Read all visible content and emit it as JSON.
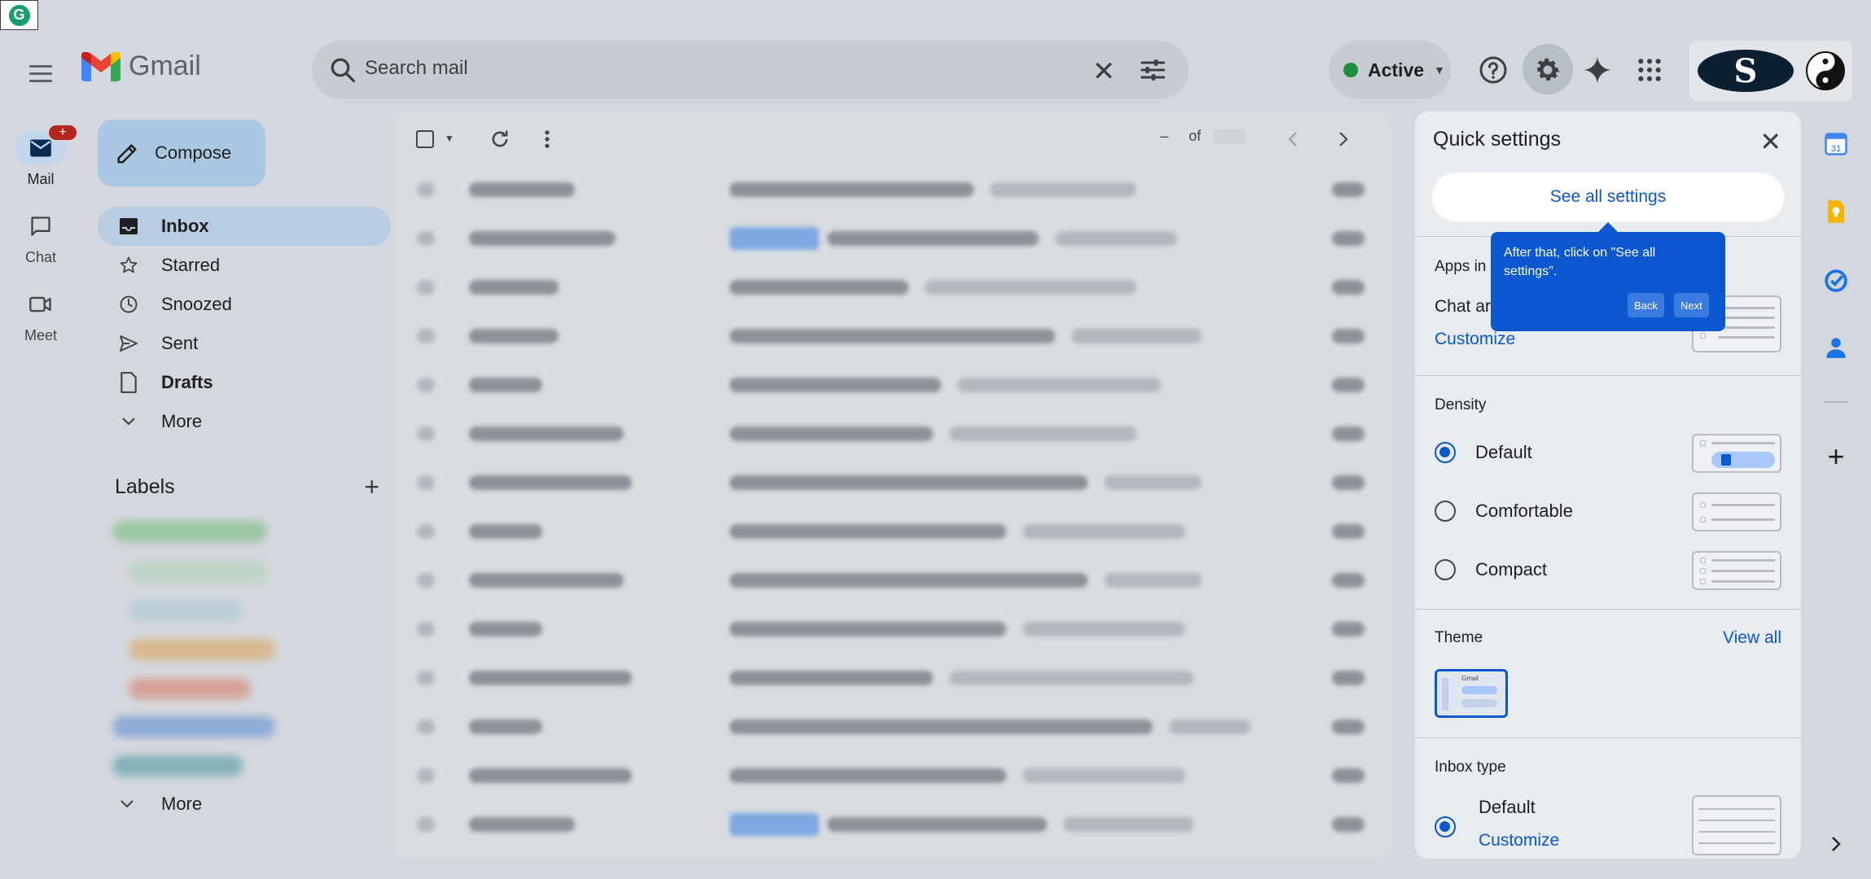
{
  "header": {
    "app_name": "Gmail",
    "search_placeholder": "Search mail",
    "status_label": "Active",
    "status_color": "#1e8e3e",
    "account_initial": "S"
  },
  "rail": {
    "mail_label": "Mail",
    "mail_badge": "+",
    "chat_label": "Chat",
    "meet_label": "Meet"
  },
  "nav": {
    "compose_label": "Compose",
    "items": [
      {
        "label": "Inbox",
        "icon": "inbox-icon"
      },
      {
        "label": "Starred",
        "icon": "star-icon"
      },
      {
        "label": "Snoozed",
        "icon": "clock-icon"
      },
      {
        "label": "Sent",
        "icon": "send-icon"
      },
      {
        "label": "Drafts",
        "icon": "draft-icon"
      },
      {
        "label": "More",
        "icon": "chevron-down-icon"
      }
    ],
    "labels_title": "Labels",
    "labels_more": "More"
  },
  "list": {
    "pager_dash": "–",
    "pager_of": "of"
  },
  "quick_settings": {
    "title": "Quick settings",
    "see_all": "See all settings",
    "apps_title": "Apps in",
    "chat_row": "Chat ar",
    "customize": "Customize",
    "density_title": "Density",
    "density_options": [
      "Default",
      "Comfortable",
      "Compact"
    ],
    "density_selected": "Default",
    "theme_title": "Theme",
    "theme_view_all": "View all",
    "theme_thumb_label": "Gmail",
    "inbox_type_title": "Inbox type",
    "inbox_type_option": "Default",
    "inbox_customize": "Customize"
  },
  "tooltip": {
    "message": "After that, click on \"See all settings\".",
    "back": "Back",
    "next": "Next"
  },
  "colors": {
    "accent": "#0b57d0",
    "badge": "#b3261e"
  }
}
